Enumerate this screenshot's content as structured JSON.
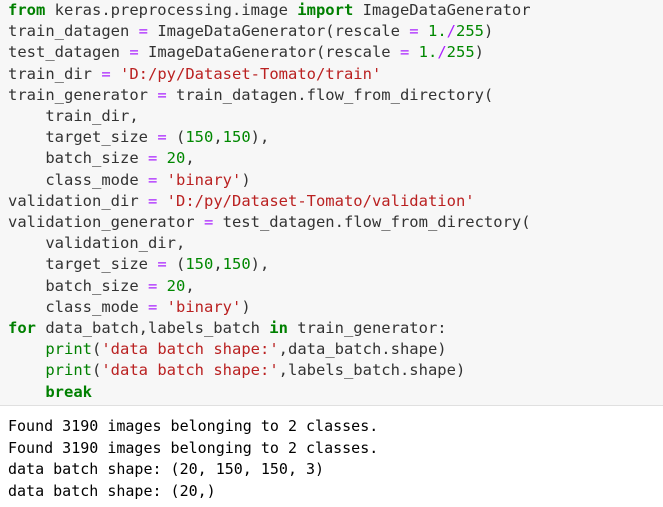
{
  "code_cell": {
    "lines": [
      [
        {
          "t": "from",
          "c": "kw"
        },
        {
          "t": " keras.preprocessing.image ",
          "c": ""
        },
        {
          "t": "import",
          "c": "kw"
        },
        {
          "t": " ImageDataGenerator",
          "c": ""
        }
      ],
      [
        {
          "t": "train_datagen ",
          "c": ""
        },
        {
          "t": "=",
          "c": "op"
        },
        {
          "t": " ImageDataGenerator(rescale ",
          "c": ""
        },
        {
          "t": "=",
          "c": "op"
        },
        {
          "t": " ",
          "c": ""
        },
        {
          "t": "1.",
          "c": "num"
        },
        {
          "t": "/",
          "c": "op"
        },
        {
          "t": "255",
          "c": "num"
        },
        {
          "t": ")",
          "c": ""
        }
      ],
      [
        {
          "t": "test_datagen ",
          "c": ""
        },
        {
          "t": "=",
          "c": "op"
        },
        {
          "t": " ImageDataGenerator(rescale ",
          "c": ""
        },
        {
          "t": "=",
          "c": "op"
        },
        {
          "t": " ",
          "c": ""
        },
        {
          "t": "1.",
          "c": "num"
        },
        {
          "t": "/",
          "c": "op"
        },
        {
          "t": "255",
          "c": "num"
        },
        {
          "t": ")",
          "c": ""
        }
      ],
      [
        {
          "t": "train_dir ",
          "c": ""
        },
        {
          "t": "=",
          "c": "op"
        },
        {
          "t": " ",
          "c": ""
        },
        {
          "t": "'D:/py/Dataset-Tomato/train'",
          "c": "str"
        }
      ],
      [
        {
          "t": "train_generator ",
          "c": ""
        },
        {
          "t": "=",
          "c": "op"
        },
        {
          "t": " train_datagen.flow_from_directory(",
          "c": ""
        }
      ],
      [
        {
          "t": "    train_dir,",
          "c": ""
        }
      ],
      [
        {
          "t": "    target_size ",
          "c": ""
        },
        {
          "t": "=",
          "c": "op"
        },
        {
          "t": " (",
          "c": ""
        },
        {
          "t": "150",
          "c": "num"
        },
        {
          "t": ",",
          "c": ""
        },
        {
          "t": "150",
          "c": "num"
        },
        {
          "t": "),",
          "c": ""
        }
      ],
      [
        {
          "t": "    batch_size ",
          "c": ""
        },
        {
          "t": "=",
          "c": "op"
        },
        {
          "t": " ",
          "c": ""
        },
        {
          "t": "20",
          "c": "num"
        },
        {
          "t": ",",
          "c": ""
        }
      ],
      [
        {
          "t": "    class_mode ",
          "c": ""
        },
        {
          "t": "=",
          "c": "op"
        },
        {
          "t": " ",
          "c": ""
        },
        {
          "t": "'binary'",
          "c": "str"
        },
        {
          "t": ")",
          "c": ""
        }
      ],
      [
        {
          "t": "validation_dir ",
          "c": ""
        },
        {
          "t": "=",
          "c": "op"
        },
        {
          "t": " ",
          "c": ""
        },
        {
          "t": "'D:/py/Dataset-Tomato/validation'",
          "c": "str"
        }
      ],
      [
        {
          "t": "validation_generator ",
          "c": ""
        },
        {
          "t": "=",
          "c": "op"
        },
        {
          "t": " test_datagen.flow_from_directory(",
          "c": ""
        }
      ],
      [
        {
          "t": "    validation_dir,",
          "c": ""
        }
      ],
      [
        {
          "t": "    target_size ",
          "c": ""
        },
        {
          "t": "=",
          "c": "op"
        },
        {
          "t": " (",
          "c": ""
        },
        {
          "t": "150",
          "c": "num"
        },
        {
          "t": ",",
          "c": ""
        },
        {
          "t": "150",
          "c": "num"
        },
        {
          "t": "),",
          "c": ""
        }
      ],
      [
        {
          "t": "    batch_size ",
          "c": ""
        },
        {
          "t": "=",
          "c": "op"
        },
        {
          "t": " ",
          "c": ""
        },
        {
          "t": "20",
          "c": "num"
        },
        {
          "t": ",",
          "c": ""
        }
      ],
      [
        {
          "t": "    class_mode ",
          "c": ""
        },
        {
          "t": "=",
          "c": "op"
        },
        {
          "t": " ",
          "c": ""
        },
        {
          "t": "'binary'",
          "c": "str"
        },
        {
          "t": ")",
          "c": ""
        }
      ],
      [
        {
          "t": "for",
          "c": "kw"
        },
        {
          "t": " data_batch,labels_batch ",
          "c": ""
        },
        {
          "t": "in",
          "c": "kw"
        },
        {
          "t": " train_generator:",
          "c": ""
        }
      ],
      [
        {
          "t": "    ",
          "c": ""
        },
        {
          "t": "print",
          "c": "bi"
        },
        {
          "t": "(",
          "c": ""
        },
        {
          "t": "'data batch shape:'",
          "c": "str"
        },
        {
          "t": ",data_batch.shape)",
          "c": ""
        }
      ],
      [
        {
          "t": "    ",
          "c": ""
        },
        {
          "t": "print",
          "c": "bi"
        },
        {
          "t": "(",
          "c": ""
        },
        {
          "t": "'data batch shape:'",
          "c": "str"
        },
        {
          "t": ",labels_batch.shape)",
          "c": ""
        }
      ],
      [
        {
          "t": "    ",
          "c": ""
        },
        {
          "t": "break",
          "c": "kw"
        }
      ]
    ]
  },
  "output": {
    "lines": [
      "Found 3190 images belonging to 2 classes.",
      "Found 3190 images belonging to 2 classes.",
      "data batch shape: (20, 150, 150, 3)",
      "data batch shape: (20,)"
    ]
  },
  "colors": {
    "cell_background": "#f7f7f7",
    "keyword": "#008000",
    "number": "#008800",
    "string": "#ba2121",
    "operator": "#aa22ff"
  }
}
